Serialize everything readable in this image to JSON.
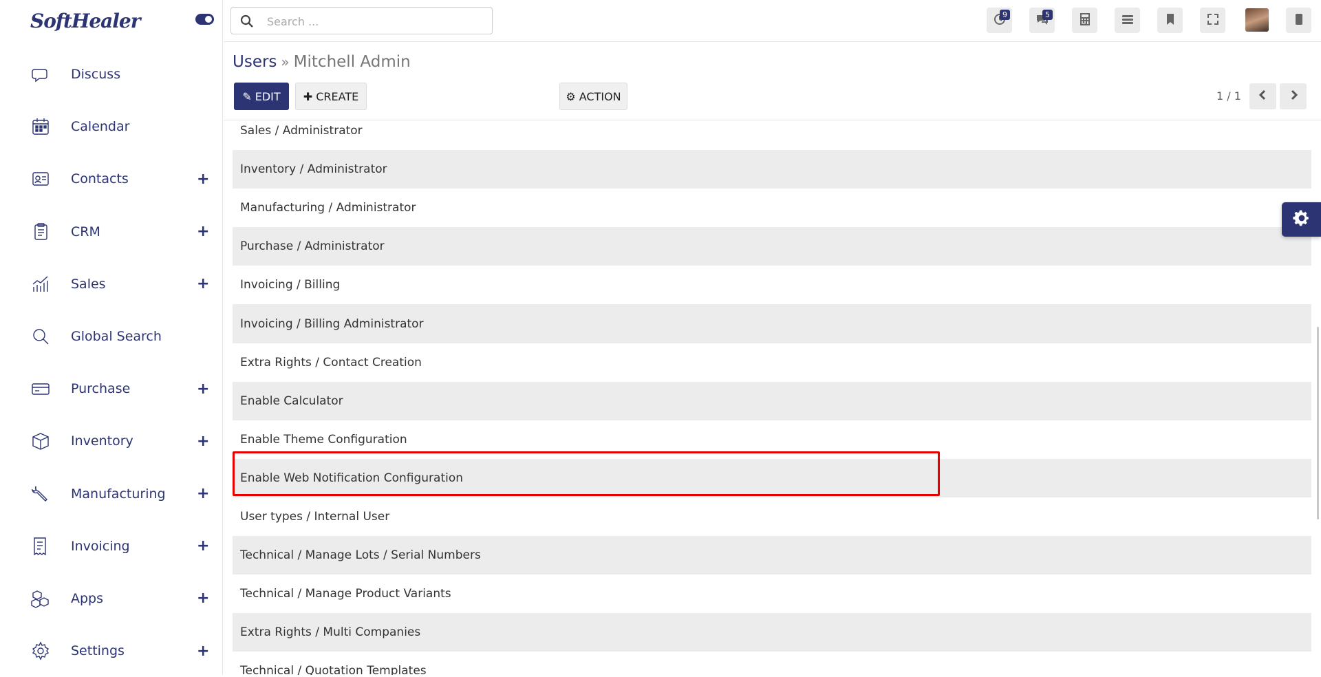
{
  "app": {
    "logo": "SoftHealer"
  },
  "sidebar": {
    "items": [
      {
        "label": "Discuss",
        "icon": "chat-bubble-icon",
        "has_plus": false
      },
      {
        "label": "Calendar",
        "icon": "calendar-icon",
        "has_plus": false
      },
      {
        "label": "Contacts",
        "icon": "contact-card-icon",
        "has_plus": true
      },
      {
        "label": "CRM",
        "icon": "clipboard-icon",
        "has_plus": true
      },
      {
        "label": "Sales",
        "icon": "sales-chart-icon",
        "has_plus": true
      },
      {
        "label": "Global Search",
        "icon": "magnifier-icon",
        "has_plus": false
      },
      {
        "label": "Purchase",
        "icon": "credit-card-icon",
        "has_plus": true
      },
      {
        "label": "Inventory",
        "icon": "box-icon",
        "has_plus": true
      },
      {
        "label": "Manufacturing",
        "icon": "wrench-icon",
        "has_plus": true
      },
      {
        "label": "Invoicing",
        "icon": "invoice-icon",
        "has_plus": true
      },
      {
        "label": "Apps",
        "icon": "cubes-icon",
        "has_plus": true
      },
      {
        "label": "Settings",
        "icon": "gear-icon",
        "has_plus": true
      }
    ],
    "plus_symbol": "+"
  },
  "topbar": {
    "search_placeholder": "Search ...",
    "activity_badge": "9",
    "messages_badge": "5"
  },
  "breadcrumb": {
    "parent": "Users",
    "separator": "»",
    "current": "Mitchell Admin"
  },
  "toolbar": {
    "edit_label": "EDIT",
    "create_label": "CREATE",
    "action_label": "ACTION",
    "pager": "1 / 1"
  },
  "rows": [
    "Sales / Administrator",
    "Inventory / Administrator",
    "Manufacturing / Administrator",
    "Purchase / Administrator",
    "Invoicing / Billing",
    "Invoicing / Billing Administrator",
    "Extra Rights / Contact Creation",
    "Enable Calculator",
    "Enable Theme Configuration",
    "Enable Web Notification Configuration",
    "User types / Internal User",
    "Technical / Manage Lots / Serial Numbers",
    "Technical / Manage Product Variants",
    "Extra Rights / Multi Companies",
    "Technical / Quotation Templates"
  ],
  "highlighted_row": "Enable Web Notification Configuration",
  "colors": {
    "brand": "#2c3474",
    "highlight_border": "#e60000",
    "row_stripe": "#ececec"
  }
}
